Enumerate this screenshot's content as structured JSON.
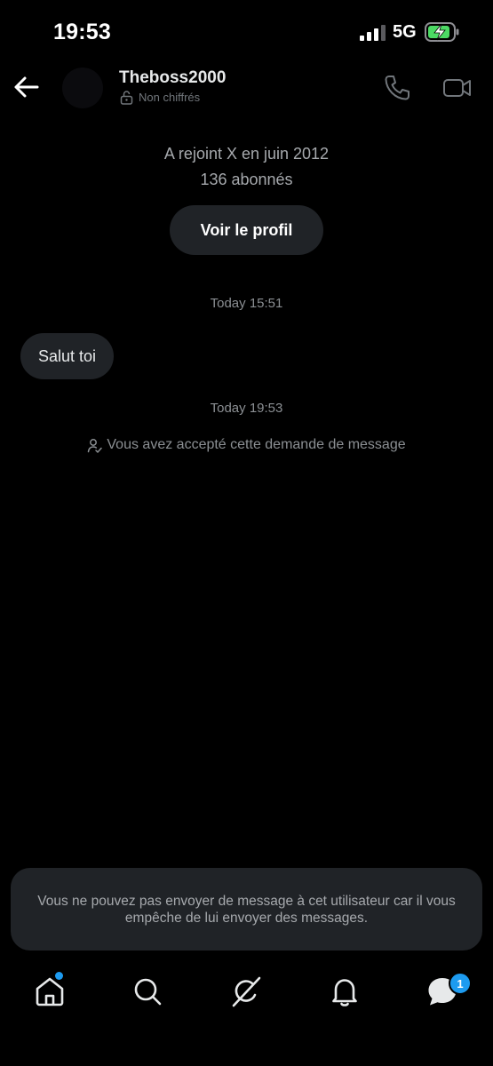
{
  "status_bar": {
    "time": "19:53",
    "network": "5G",
    "battery_state": "charging",
    "signal_bars": 3
  },
  "header": {
    "username": "Theboss2000",
    "encryption_status": "Non chiffrés",
    "icons": [
      "back-arrow-icon",
      "lock-open-icon",
      "phone-icon",
      "video-camera-icon"
    ]
  },
  "profile_summary": {
    "joined": "A rejoint X en juin 2012",
    "followers": "136 abonnés",
    "view_profile_label": "Voir le profil"
  },
  "conversation": {
    "messages": [
      {
        "timestamp": "Today 15:51",
        "text": "Salut toi",
        "direction": "received"
      }
    ],
    "event_timestamp": "Today 19:53",
    "event_text": "Vous avez accepté cette demande de message"
  },
  "blocked_notice": {
    "text": "Vous ne pouvez pas envoyer de message à cet utilisateur car il vous empêche de lui envoyer des messages."
  },
  "bottom_nav": {
    "items": [
      "home-icon",
      "search-icon",
      "grok-icon",
      "bell-icon",
      "messages-icon"
    ],
    "messages_badge": "1",
    "accent_color": "#1d9bf0"
  },
  "colors": {
    "background": "#000000",
    "surface": "#202327",
    "secondary_text": "#8b8f93"
  }
}
